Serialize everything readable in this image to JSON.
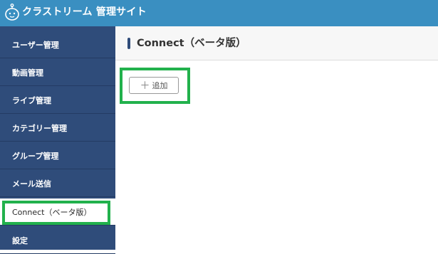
{
  "header": {
    "logo_icon": "mascot-logo-icon",
    "app_title": "クラストリーム 管理サイト"
  },
  "sidebar": {
    "items": [
      {
        "label": "ユーザー管理"
      },
      {
        "label": "動画管理"
      },
      {
        "label": "ライブ管理"
      },
      {
        "label": "カテゴリー管理"
      },
      {
        "label": "グループ管理"
      },
      {
        "label": "メール送信"
      },
      {
        "label": "Connect（ベータ版）",
        "active": true
      },
      {
        "label": "設定"
      }
    ]
  },
  "main": {
    "title": "Connect（ベータ版）",
    "add_button": {
      "icon": "plus-icon",
      "label": "追加"
    }
  },
  "colors": {
    "header_bg": "#3a8fc1",
    "sidebar_bg": "#2f4c7a",
    "highlight": "#22b14c"
  }
}
